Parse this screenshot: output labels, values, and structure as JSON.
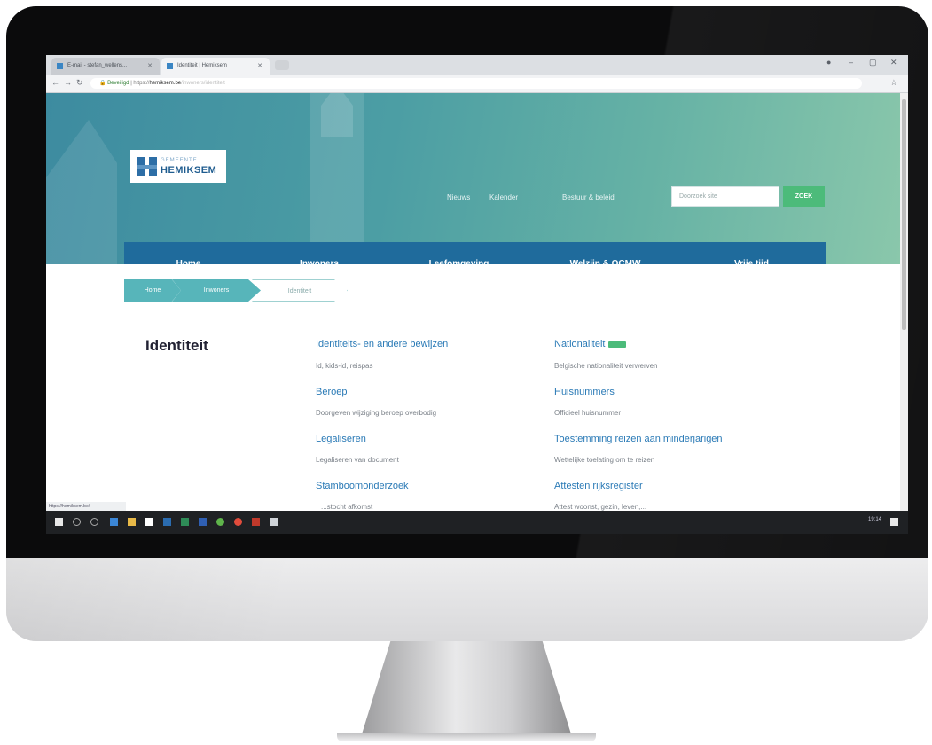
{
  "browser": {
    "tabs": [
      {
        "label": "E-mail - stefan_wellens..."
      },
      {
        "label": "Identiteit | Hemiksem"
      }
    ],
    "address": {
      "secure_label": "Beveiligd",
      "protocol": "https://",
      "domain": "hemiksem.be",
      "path": "/inwoners/identiteit"
    },
    "status_url": "https://hemiksem.be/"
  },
  "site": {
    "logo": {
      "top_text": "GEMEENTE",
      "name": "HEMIKSEM"
    },
    "top_links": [
      "Nieuws",
      "Kalender",
      "Bestuur & beleid"
    ],
    "search": {
      "placeholder": "Doorzoek site",
      "button": "ZOEK"
    },
    "main_nav": [
      "Home",
      "Inwoners",
      "Leefomgeving",
      "Welzijn & OCMW",
      "Vrije tijd"
    ],
    "breadcrumb": [
      "Home",
      "Inwoners",
      "Identiteit"
    ],
    "page_title": "Identiteit",
    "left_column": [
      {
        "title": "Identiteits- en andere bewijzen",
        "desc": "Id, kids-id, reispas"
      },
      {
        "title": "Beroep",
        "desc": "Doorgeven wijziging beroep overbodig"
      },
      {
        "title": "Legaliseren",
        "desc": "Legaliseren van document"
      },
      {
        "title": "Stamboomonderzoek",
        "desc": "...stocht afkomst"
      }
    ],
    "right_column": [
      {
        "title": "Nationaliteit",
        "desc": "Belgische nationaliteit verwerven"
      },
      {
        "title": "Huisnummers",
        "desc": "Officieel huisnummer"
      },
      {
        "title": "Toestemming reizen aan minderjarigen",
        "desc": "Wettelijke toelating om te reizen"
      },
      {
        "title": "Attesten rijksregister",
        "desc": "Attest woonst, gezin, leven,..."
      }
    ]
  },
  "taskbar": {
    "time": "19:14"
  },
  "colors": {
    "nav_blue": "#1f6b9c",
    "link_blue": "#2a7ab6",
    "accent_green": "#4cbb7a",
    "breadcrumb_teal": "#57b5ba"
  }
}
